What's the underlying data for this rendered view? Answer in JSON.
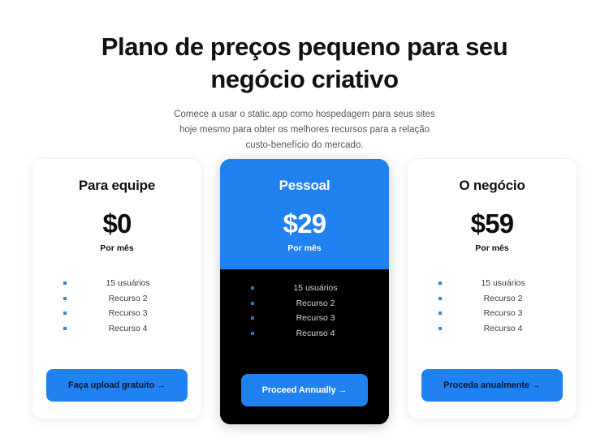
{
  "header": {
    "title": "Plano de preços pequeno para seu negócio criativo",
    "subtitle": "Comece a usar o static.app como hospedagem para seus sites hoje mesmo para obter os melhores recursos para a relação custo-benefício do mercado."
  },
  "colors": {
    "accent_blue": "#2081f0",
    "featured_body": "#000000",
    "page_background": "#ffffff",
    "bullet_blue": "#3d7fd6",
    "heading_text": "#111111",
    "body_text": "#555555"
  },
  "plans": [
    {
      "name": "Para equipe",
      "price": "$0",
      "period": "Por mês",
      "features": [
        "15 usuários",
        "Recurso 2",
        "Recurso 3",
        "Recurso 4"
      ],
      "cta_label": "Faça upload gratuito →",
      "featured": false
    },
    {
      "name": "Pessoal",
      "price": "$29",
      "period": "Por mês",
      "features": [
        "15 usuários",
        "Recurso 2",
        "Recurso 3",
        "Recurso 4"
      ],
      "cta_label": "Proceed Annually →",
      "featured": true
    },
    {
      "name": "O negócio",
      "price": "$59",
      "period": "Por mês",
      "features": [
        "15 usuários",
        "Recurso 2",
        "Recurso 3",
        "Recurso 4"
      ],
      "cta_label": "Proceda anualmente →",
      "featured": false
    }
  ]
}
